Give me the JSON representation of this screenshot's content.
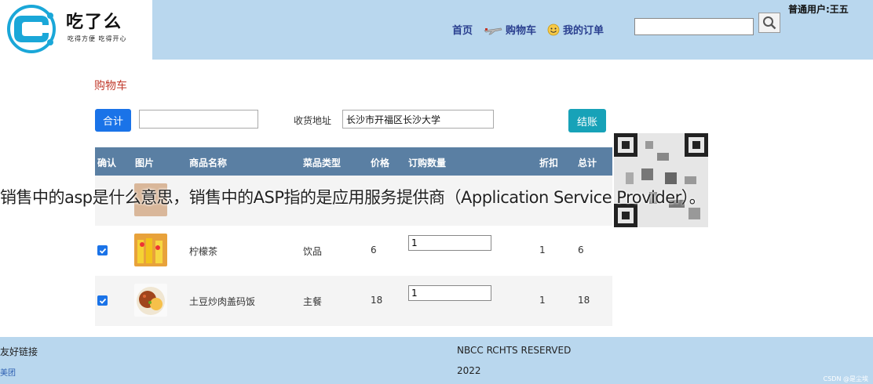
{
  "header": {
    "logo_title": "吃了么",
    "logo_subtitle": "吃得方便 吃得开心",
    "nav": [
      {
        "label": "首页",
        "icon": "home"
      },
      {
        "label": "购物车",
        "icon": "plane-icon"
      },
      {
        "label": "我的订单",
        "icon": "smiley-icon"
      }
    ],
    "search": {
      "value": "",
      "placeholder": ""
    },
    "user_label": "普通用户:王五"
  },
  "cart": {
    "title": "购物车",
    "total_button": "合计",
    "total_value": "",
    "address_label": "收货地址",
    "address_value": "长沙市开福区长沙大学",
    "checkout_button": "结账"
  },
  "table": {
    "headers": [
      "确认",
      "图片",
      "商品名称",
      "菜品类型",
      "价格",
      "订购数量",
      "折扣",
      "总计"
    ],
    "rows": [
      {
        "name": "柠檬茶",
        "type": "饮品",
        "price": "6",
        "qty": "1",
        "discount": "1",
        "total": "6",
        "checked": true
      },
      {
        "name": "土豆炒肉盖码饭",
        "type": "主餐",
        "price": "18",
        "qty": "1",
        "discount": "1",
        "total": "18",
        "checked": true
      }
    ]
  },
  "overlay_caption": "销售中的asp是什么意思，销售中的ASP指的是应用服务提供商（Application Service Provider）。",
  "footer": {
    "links_title": "友好链接",
    "link": "美团",
    "copyright": "NBCC RCHTS RESERVED",
    "year": "2022",
    "watermark": "CSDN @是尘埃"
  },
  "colors": {
    "header_bg": "#b9d7ee",
    "table_head": "#5a7fa3",
    "primary_button": "#1a73e8",
    "checkout_button": "#17a2b8",
    "cart_title": "#c0392b"
  }
}
